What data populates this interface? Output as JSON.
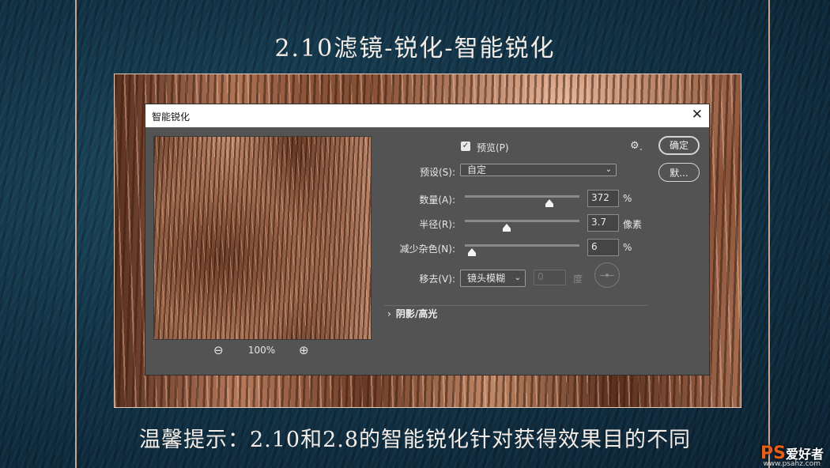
{
  "slide": {
    "title": "2.10滤镜-锐化-智能锐化",
    "tip": "温馨提示：2.10和2.8的智能锐化针对获得效果目的不同"
  },
  "dialog": {
    "title": "智能锐化",
    "zoom_level": "100%",
    "preview_label": "预览(P)",
    "preview_checked": true,
    "preset": {
      "label": "预设(S):",
      "value": "自定"
    },
    "amount": {
      "label": "数量(A):",
      "value": "372",
      "unit": "%",
      "slider_fraction": 0.73
    },
    "radius": {
      "label": "半径(R):",
      "value": "3.7",
      "unit": "像素",
      "slider_fraction": 0.36
    },
    "reduce_noise": {
      "label": "减少杂色(N):",
      "value": "6",
      "unit": "%",
      "slider_fraction": 0.06
    },
    "remove": {
      "label": "移去(V):",
      "value": "镜头模糊",
      "angle_value": "0",
      "angle_unit": "度"
    },
    "shadows_section": "阴影/高光",
    "ok_button": "确定",
    "default_button": "默..."
  },
  "watermark": {
    "brand": "PS",
    "text": "爱好者",
    "url": "www.psahz.com"
  }
}
